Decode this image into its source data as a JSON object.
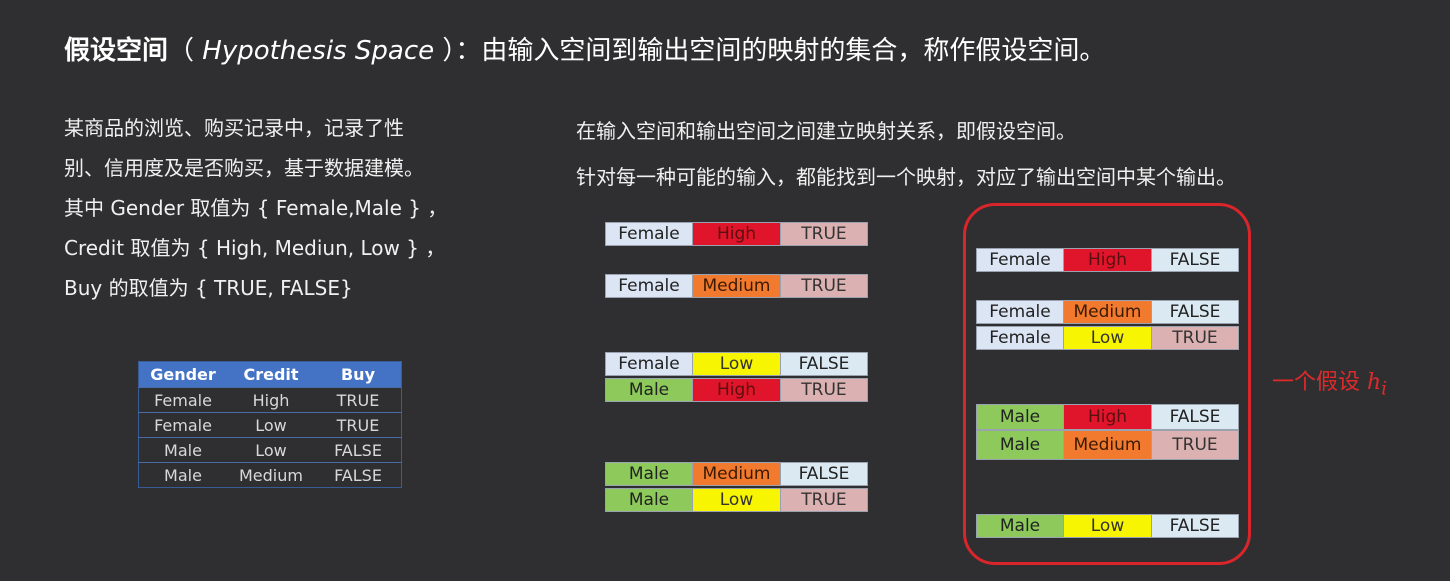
{
  "title": {
    "bold": "假设空间",
    "open_paren": "（ ",
    "english": "Hypothesis Space",
    "close_paren": " ）",
    "rest": "：由输入空间到输出空间的映射的集合，称作假设空间。"
  },
  "left_text": [
    "某商品的浏览、购买记录中，记录了性",
    "别、信用度及是否购买，基于数据建模。",
    "其中 Gender 取值为 { Female,Male } ，",
    "Credit 取值为 { High, Mediun, Low } ，",
    "Buy 的取值为 { TRUE, FALSE}"
  ],
  "right_text": [
    "在输入空间和输出空间之间建立映射关系，即假设空间。",
    "针对每一种可能的输入，都能找到一个映射，对应了输出空间中某个输出。"
  ],
  "data_table": {
    "headers": [
      "Gender",
      "Credit",
      "Buy"
    ],
    "rows": [
      [
        "Female",
        "High",
        "TRUE"
      ],
      [
        "Female",
        "Low",
        "TRUE"
      ],
      [
        "Male",
        "Low",
        "FALSE"
      ],
      [
        "Male",
        "Medium",
        "FALSE"
      ]
    ]
  },
  "left_mappings": [
    [
      "Female",
      "High",
      "TRUE"
    ],
    [
      "Female",
      "Medium",
      "TRUE"
    ],
    [
      "Female",
      "Low",
      "FALSE"
    ],
    [
      "Male",
      "High",
      "TRUE"
    ],
    [
      "Male",
      "Medium",
      "FALSE"
    ],
    [
      "Male",
      "Low",
      "TRUE"
    ]
  ],
  "hypothesis_mappings": [
    [
      "Female",
      "High",
      "FALSE"
    ],
    [
      "Female",
      "Medium",
      "FALSE"
    ],
    [
      "Female",
      "Low",
      "TRUE"
    ],
    [
      "Male",
      "High",
      "FALSE"
    ],
    [
      "Male",
      "Medium",
      "TRUE"
    ],
    [
      "Male",
      "Low",
      "FALSE"
    ]
  ],
  "hypothesis_label": {
    "text": "一个假设 ",
    "symbol": "h",
    "subscript": "i"
  },
  "colors": {
    "background": "#2f2f31",
    "female": "#dbe5f3",
    "male": "#8dc95b",
    "high": "#e0142a",
    "medium": "#f27a2f",
    "low": "#f8f503",
    "true": "#dcb1b2",
    "false": "#dbe9f2",
    "table_header": "#4473c5",
    "hypothesis_outline": "#d9262a"
  }
}
